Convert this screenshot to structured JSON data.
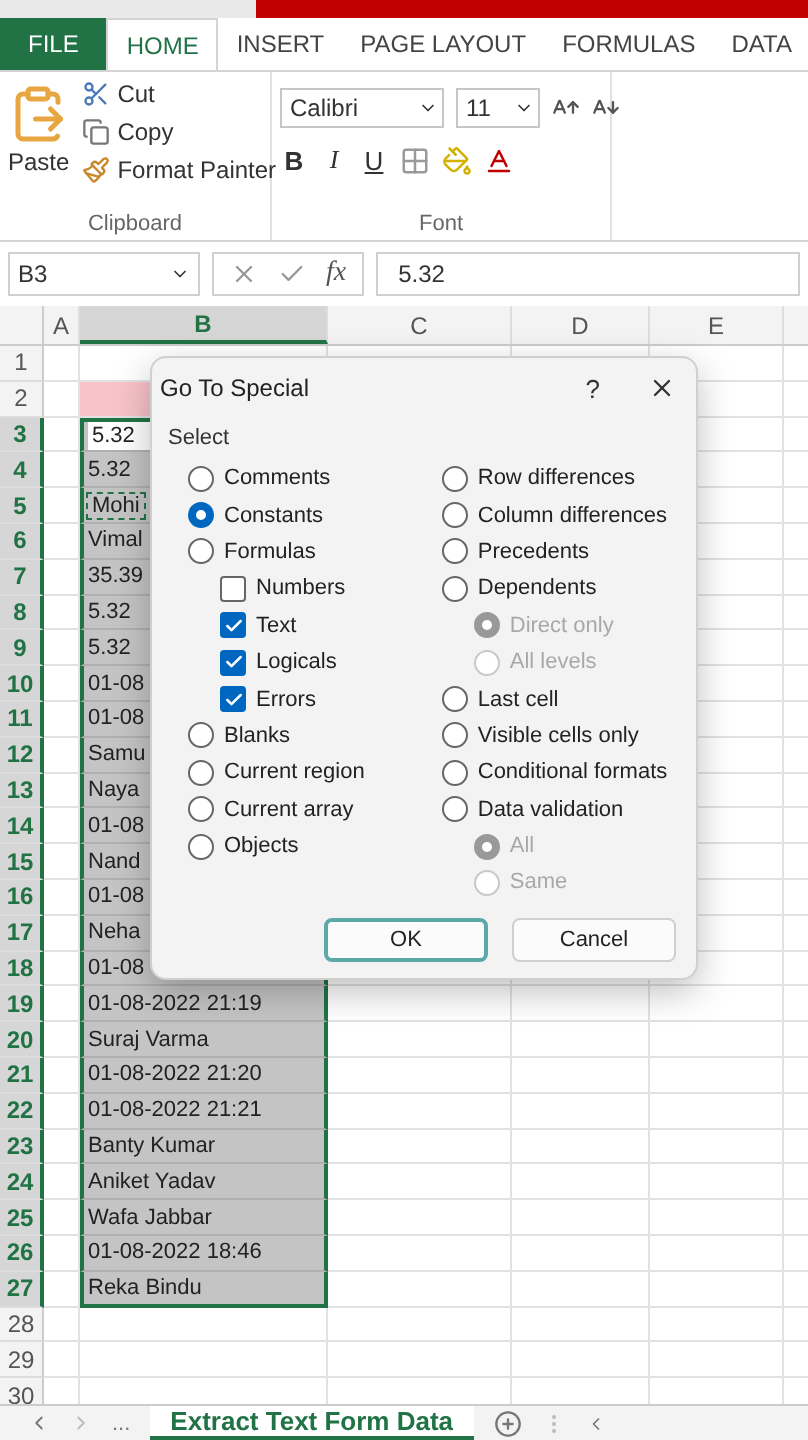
{
  "ribbon_tabs": [
    {
      "label": "FILE",
      "kind": "file",
      "selected": false
    },
    {
      "label": "HOME",
      "kind": "tab",
      "selected": true
    },
    {
      "label": "INSERT",
      "kind": "tab",
      "selected": false
    },
    {
      "label": "PAGE LAYOUT",
      "kind": "tab",
      "selected": false
    },
    {
      "label": "FORMULAS",
      "kind": "tab",
      "selected": false
    },
    {
      "label": "DATA",
      "kind": "tab",
      "selected": false
    }
  ],
  "clipboard": {
    "paste": "Paste",
    "cut": "Cut",
    "copy": "Copy",
    "format_painter": "Format Painter",
    "label": "Clipboard"
  },
  "font": {
    "name": "Calibri",
    "size": "11",
    "bold": "B",
    "italic": "I",
    "underline": "U",
    "label": "Font"
  },
  "formula_bar": {
    "name_box": "B3",
    "function_label": "fx",
    "formula": "5.32"
  },
  "columns": [
    {
      "label": "A",
      "selected": false
    },
    {
      "label": "B",
      "selected": true
    },
    {
      "label": "C",
      "selected": false
    },
    {
      "label": "D",
      "selected": false
    },
    {
      "label": "E",
      "selected": false
    }
  ],
  "rows": [
    {
      "number": "1",
      "selected": false
    },
    {
      "number": "2",
      "selected": false,
      "cell": {
        "kind": "highlight"
      }
    },
    {
      "number": "3",
      "selected": true,
      "cell": {
        "kind": "active",
        "text": "5.32"
      }
    },
    {
      "number": "4",
      "selected": true,
      "cell": {
        "kind": "selected",
        "text": "5.32"
      }
    },
    {
      "number": "5",
      "selected": true,
      "cell": {
        "kind": "copied",
        "text": "Mohi"
      }
    },
    {
      "number": "6",
      "selected": true,
      "cell": {
        "kind": "selected",
        "text": "Vimal"
      }
    },
    {
      "number": "7",
      "selected": true,
      "cell": {
        "kind": "selected",
        "text": "35.39"
      }
    },
    {
      "number": "8",
      "selected": true,
      "cell": {
        "kind": "selected",
        "text": "5.32"
      }
    },
    {
      "number": "9",
      "selected": true,
      "cell": {
        "kind": "selected",
        "text": "5.32"
      }
    },
    {
      "number": "10",
      "selected": true,
      "cell": {
        "kind": "selected",
        "text": "01-08"
      }
    },
    {
      "number": "11",
      "selected": true,
      "cell": {
        "kind": "selected",
        "text": "01-08"
      }
    },
    {
      "number": "12",
      "selected": true,
      "cell": {
        "kind": "selected",
        "text": "Samu"
      }
    },
    {
      "number": "13",
      "selected": true,
      "cell": {
        "kind": "selected",
        "text": "Naya"
      }
    },
    {
      "number": "14",
      "selected": true,
      "cell": {
        "kind": "selected",
        "text": "01-08"
      }
    },
    {
      "number": "15",
      "selected": true,
      "cell": {
        "kind": "selected",
        "text": "Nand"
      }
    },
    {
      "number": "16",
      "selected": true,
      "cell": {
        "kind": "selected",
        "text": "01-08"
      }
    },
    {
      "number": "17",
      "selected": true,
      "cell": {
        "kind": "selected",
        "text": "Neha"
      }
    },
    {
      "number": "18",
      "selected": true,
      "cell": {
        "kind": "selected",
        "text": "01-08"
      }
    },
    {
      "number": "19",
      "selected": true,
      "cell": {
        "kind": "selected",
        "text": "01-08-2022 21:19"
      }
    },
    {
      "number": "20",
      "selected": true,
      "cell": {
        "kind": "selected",
        "text": "Suraj Varma"
      }
    },
    {
      "number": "21",
      "selected": true,
      "cell": {
        "kind": "selected",
        "text": "01-08-2022 21:20"
      }
    },
    {
      "number": "22",
      "selected": true,
      "cell": {
        "kind": "selected",
        "text": "01-08-2022 21:21"
      }
    },
    {
      "number": "23",
      "selected": true,
      "cell": {
        "kind": "selected",
        "text": "Banty Kumar"
      }
    },
    {
      "number": "24",
      "selected": true,
      "cell": {
        "kind": "selected",
        "text": "Aniket Yadav"
      }
    },
    {
      "number": "25",
      "selected": true,
      "cell": {
        "kind": "selected",
        "text": "Wafa Jabbar"
      }
    },
    {
      "number": "26",
      "selected": true,
      "cell": {
        "kind": "selected",
        "text": "01-08-2022 18:46"
      }
    },
    {
      "number": "27",
      "selected": true,
      "cell": {
        "kind": "selected",
        "text": "Reka Bindu"
      }
    },
    {
      "number": "28",
      "selected": false
    },
    {
      "number": "29",
      "selected": false
    },
    {
      "number": "30",
      "selected": false
    }
  ],
  "dialog": {
    "title": "Go To Special",
    "help": "?",
    "group_label": "Select",
    "left": [
      {
        "label": "Comments",
        "kind": "radio",
        "selected": false,
        "disabled": false
      },
      {
        "label": "Constants",
        "kind": "radio",
        "selected": true,
        "disabled": false
      },
      {
        "label": "Formulas",
        "kind": "radio",
        "selected": false,
        "disabled": false,
        "children": [
          {
            "label": "Numbers",
            "kind": "checkbox",
            "checked": false,
            "disabled": false
          },
          {
            "label": "Text",
            "kind": "checkbox",
            "checked": true,
            "disabled": false
          },
          {
            "label": "Logicals",
            "kind": "checkbox",
            "checked": true,
            "disabled": false
          },
          {
            "label": "Errors",
            "kind": "checkbox",
            "checked": true,
            "disabled": false
          }
        ]
      },
      {
        "label": "Blanks",
        "kind": "radio",
        "selected": false,
        "disabled": false
      },
      {
        "label": "Current region",
        "kind": "radio",
        "selected": false,
        "disabled": false
      },
      {
        "label": "Current array",
        "kind": "radio",
        "selected": false,
        "disabled": false
      },
      {
        "label": "Objects",
        "kind": "radio",
        "selected": false,
        "disabled": false
      }
    ],
    "right": [
      {
        "label": "Row differences",
        "kind": "radio",
        "selected": false,
        "disabled": false
      },
      {
        "label": "Column differences",
        "kind": "radio",
        "selected": false,
        "disabled": false
      },
      {
        "label": "Precedents",
        "kind": "radio",
        "selected": false,
        "disabled": false
      },
      {
        "label": "Dependents",
        "kind": "radio",
        "selected": false,
        "disabled": false,
        "children": [
          {
            "label": "Direct only",
            "kind": "radio",
            "selected": true,
            "disabled": true
          },
          {
            "label": "All levels",
            "kind": "radio",
            "selected": false,
            "disabled": true
          }
        ]
      },
      {
        "label": "Last cell",
        "kind": "radio",
        "selected": false,
        "disabled": false
      },
      {
        "label": "Visible cells only",
        "kind": "radio",
        "selected": false,
        "disabled": false
      },
      {
        "label": "Conditional formats",
        "kind": "radio",
        "selected": false,
        "disabled": false
      },
      {
        "label": "Data validation",
        "kind": "radio",
        "selected": false,
        "disabled": false,
        "children": [
          {
            "label": "All",
            "kind": "radio",
            "selected": true,
            "disabled": true
          },
          {
            "label": "Same",
            "kind": "radio",
            "selected": false,
            "disabled": true
          }
        ]
      }
    ],
    "buttons": [
      {
        "label": "OK",
        "kind": "default"
      },
      {
        "label": "Cancel",
        "kind": "normal"
      }
    ]
  },
  "sheet_nav": {
    "more": "..."
  },
  "sheet_tabs": [
    {
      "label": "Extract Text Form Data",
      "selected": true
    }
  ]
}
